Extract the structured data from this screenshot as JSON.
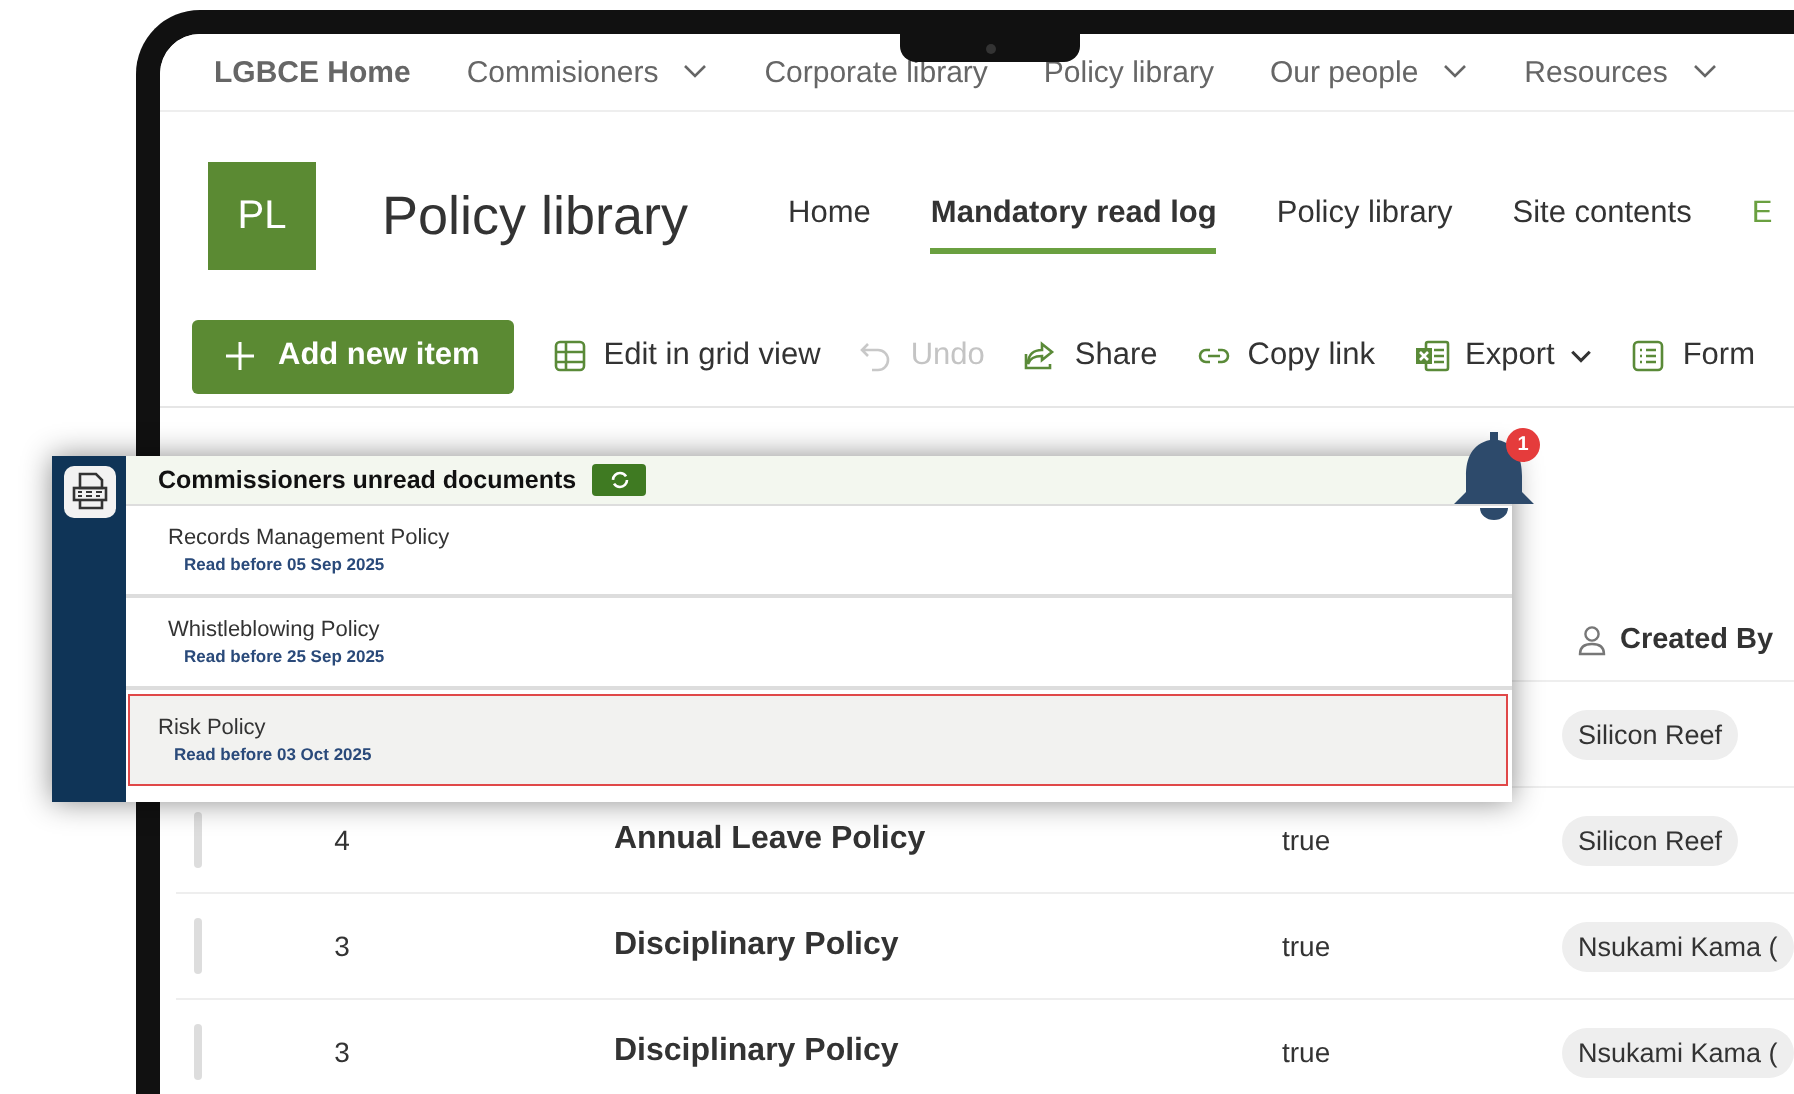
{
  "top_nav": {
    "site_home": "LGBCE Home",
    "items": [
      {
        "label": "Commisioners",
        "dropdown": true
      },
      {
        "label": "Corporate library",
        "dropdown": false
      },
      {
        "label": "Policy library",
        "dropdown": false
      },
      {
        "label": "Our people",
        "dropdown": true
      },
      {
        "label": "Resources",
        "dropdown": true
      }
    ]
  },
  "header": {
    "logo": "PL",
    "title": "Policy library",
    "nav": [
      {
        "label": "Home",
        "selected": false
      },
      {
        "label": "Mandatory read log",
        "selected": true
      },
      {
        "label": "Policy library",
        "selected": false
      },
      {
        "label": "Site contents",
        "selected": false
      },
      {
        "label": "E",
        "selected": false,
        "kind": "edit"
      }
    ]
  },
  "toolbar": {
    "primary": "Add new item",
    "actions": [
      {
        "kind": "grid",
        "label": "Edit in grid view",
        "disabled": false,
        "dropdown": false
      },
      {
        "kind": "undo",
        "label": "Undo",
        "disabled": true,
        "dropdown": false
      },
      {
        "kind": "share",
        "label": "Share",
        "disabled": false,
        "dropdown": false
      },
      {
        "kind": "link",
        "label": "Copy link",
        "disabled": false,
        "dropdown": false
      },
      {
        "kind": "excel",
        "label": "Export",
        "disabled": false,
        "dropdown": true
      },
      {
        "kind": "form",
        "label": "Form",
        "disabled": false,
        "dropdown": false
      }
    ]
  },
  "table": {
    "columns": [
      {
        "label": "Created By"
      }
    ],
    "rows": [
      {
        "created_by": "Silicon Reef"
      },
      {
        "number": "4",
        "title": "Annual Leave Policy",
        "flag": "true",
        "created_by": "Silicon Reef"
      },
      {
        "number": "3",
        "title": "Disciplinary Policy",
        "flag": "true",
        "created_by": "Nsukami Kama ("
      },
      {
        "number": "3",
        "title": "Disciplinary Policy",
        "flag": "true",
        "created_by": "Nsukami Kama ("
      }
    ]
  },
  "popup": {
    "title": "Commissioners unread documents",
    "notification_count": "1",
    "items": [
      {
        "title": "Records Management Policy",
        "due": "Read before 05 Sep 2025",
        "selected": false
      },
      {
        "title": "Whistleblowing Policy",
        "due": "Read before 25 Sep 2025",
        "selected": false
      },
      {
        "title": "Risk Policy",
        "due": "Read before 03 Oct 2025",
        "selected": true
      }
    ]
  }
}
